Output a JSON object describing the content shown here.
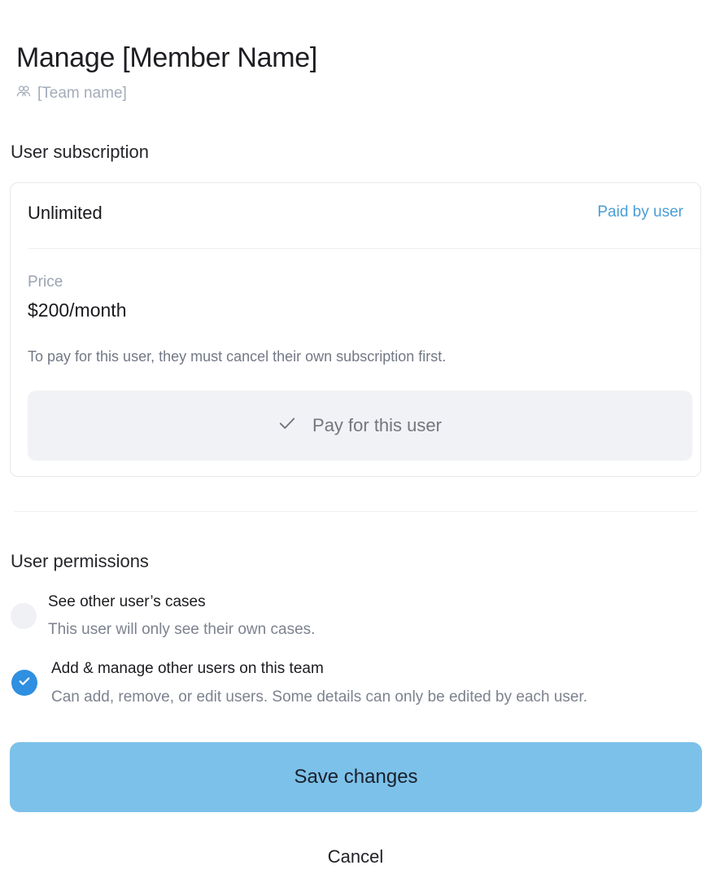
{
  "header": {
    "title": "Manage [Member Name]",
    "team_name": "[Team name]",
    "team_icon": "users-icon"
  },
  "subscription": {
    "section_label": "User subscription",
    "plan": "Unlimited",
    "paid_by": "Paid by user",
    "price_label": "Price",
    "price_value": "$200/month",
    "notice": "To pay for this user, they must cancel their own subscription first.",
    "pay_button_label": "Pay for this user",
    "pay_button_icon": "check-icon"
  },
  "permissions": {
    "section_label": "User permissions",
    "items": [
      {
        "title": "See other user’s cases",
        "description": "This user will only see their own cases.",
        "checked": false
      },
      {
        "title": "Add & manage other users on this team",
        "description": "Can add, remove, or edit users. Some details can only be edited by each user.",
        "checked": true
      }
    ]
  },
  "actions": {
    "save_label": "Save changes",
    "cancel_label": "Cancel"
  },
  "colors": {
    "accent": "#4a9fd4",
    "checkbox_checked": "#2f8fe0",
    "save_button": "#7cc1e9"
  }
}
